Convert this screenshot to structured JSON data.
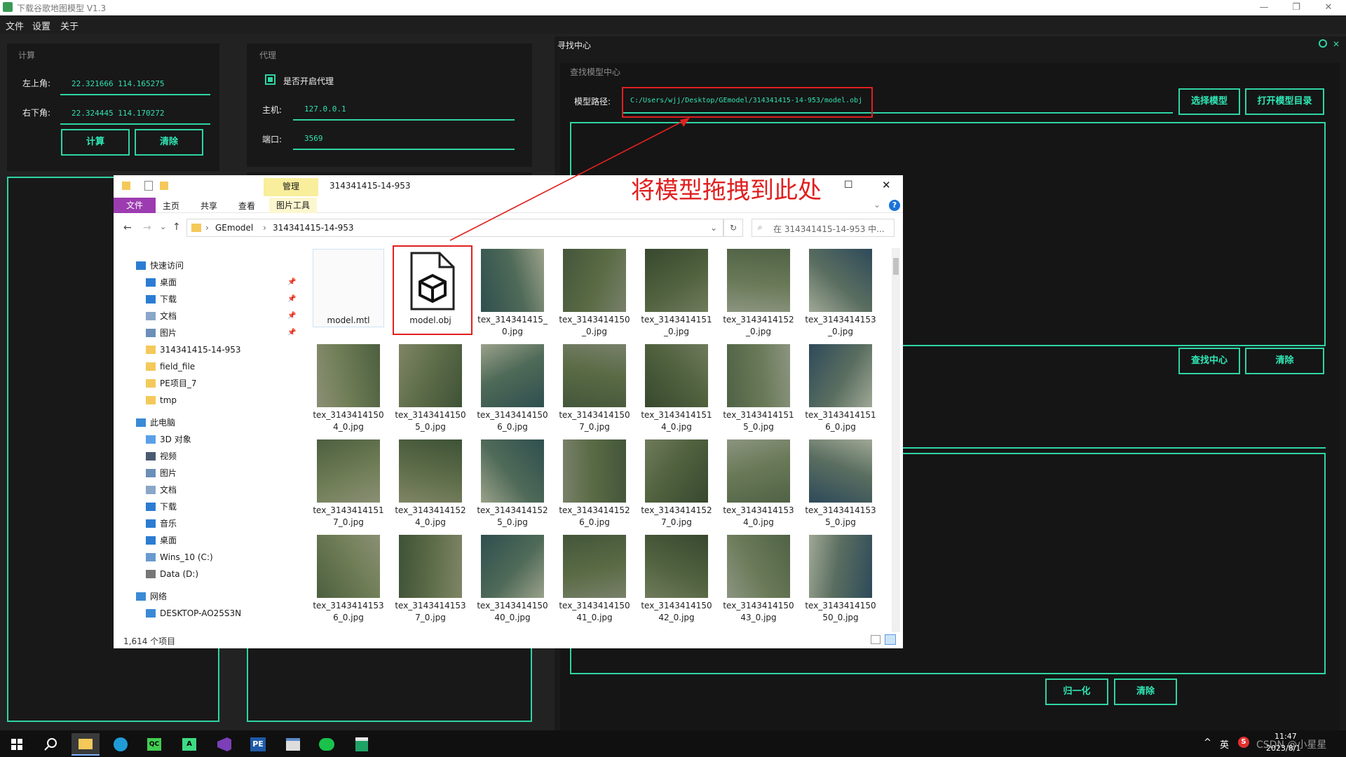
{
  "app": {
    "title": "下载谷歌地图模型 V1.3",
    "minimize": "—",
    "maximize": "❐",
    "close": "✕"
  },
  "menu": [
    "文件",
    "设置",
    "关于"
  ],
  "calc": {
    "title": "计算",
    "top_left_label": "左上角:",
    "top_left_value": "22.321666 114.165275",
    "bottom_right_label": "右下角:",
    "bottom_right_value": "22.324445 114.170272",
    "calc_btn": "计算",
    "clear_btn": "清除"
  },
  "proxy": {
    "title": "代理",
    "enable_label": "是否开启代理",
    "host_label": "主机:",
    "host_value": "127.0.0.1",
    "port_label": "端口:",
    "port_value": "3569"
  },
  "finder": {
    "tab": "寻找中心",
    "subtitle": "查找模型中心",
    "path_label": "模型路径:",
    "path_value": "C:/Users/wjj/Desktop/GEmodel/314341415-14-953/model.obj",
    "select_btn": "选择模型",
    "open_dir_btn": "打开模型目录",
    "find_btn": "查找中心",
    "clear_btn": "清除",
    "normalize_btn": "归一化",
    "clear_btn2": "清除"
  },
  "annotation": "将模型拖拽到此处",
  "explorer": {
    "title": "314341415-14-953",
    "manage_tab": "管理",
    "pic_tools": "图片工具",
    "ribbon": [
      "文件",
      "主页",
      "共享",
      "查看"
    ],
    "breadcrumb": [
      "GEmodel",
      "314341415-14-953"
    ],
    "search_placeholder": "在 314341415-14-953 中...",
    "nav": {
      "quick": "快速访问",
      "quick_items": [
        "桌面",
        "下载",
        "文档",
        "图片",
        "314341415-14-953",
        "field_file",
        "PE项目_7",
        "tmp"
      ],
      "pc": "此电脑",
      "pc_items": [
        "3D 对象",
        "视频",
        "图片",
        "文档",
        "下载",
        "音乐",
        "桌面",
        "Wins_10 (C:)",
        "Data (D:)"
      ],
      "network": "网络",
      "network_items": [
        "DESKTOP-AO25S3N"
      ]
    },
    "files": [
      {
        "l1": "model.mtl",
        "l2": ""
      },
      {
        "l1": "model.obj",
        "l2": ""
      },
      {
        "l1": "tex_314341415_",
        "l2": "0.jpg"
      },
      {
        "l1": "tex_3143414150",
        "l2": "_0.jpg"
      },
      {
        "l1": "tex_3143414151",
        "l2": "_0.jpg"
      },
      {
        "l1": "tex_3143414152",
        "l2": "_0.jpg"
      },
      {
        "l1": "tex_3143414153",
        "l2": "_0.jpg"
      },
      {
        "l1": "tex_3143414150",
        "l2": "4_0.jpg"
      },
      {
        "l1": "tex_3143414150",
        "l2": "5_0.jpg"
      },
      {
        "l1": "tex_3143414150",
        "l2": "6_0.jpg"
      },
      {
        "l1": "tex_3143414150",
        "l2": "7_0.jpg"
      },
      {
        "l1": "tex_3143414151",
        "l2": "4_0.jpg"
      },
      {
        "l1": "tex_3143414151",
        "l2": "5_0.jpg"
      },
      {
        "l1": "tex_3143414151",
        "l2": "6_0.jpg"
      },
      {
        "l1": "tex_3143414151",
        "l2": "7_0.jpg"
      },
      {
        "l1": "tex_3143414152",
        "l2": "4_0.jpg"
      },
      {
        "l1": "tex_3143414152",
        "l2": "5_0.jpg"
      },
      {
        "l1": "tex_3143414152",
        "l2": "6_0.jpg"
      },
      {
        "l1": "tex_3143414152",
        "l2": "7_0.jpg"
      },
      {
        "l1": "tex_3143414153",
        "l2": "4_0.jpg"
      },
      {
        "l1": "tex_3143414153",
        "l2": "5_0.jpg"
      },
      {
        "l1": "tex_3143414153",
        "l2": "6_0.jpg"
      },
      {
        "l1": "tex_3143414153",
        "l2": "7_0.jpg"
      },
      {
        "l1": "tex_3143414150",
        "l2": "40_0.jpg"
      },
      {
        "l1": "tex_3143414150",
        "l2": "41_0.jpg"
      },
      {
        "l1": "tex_3143414150",
        "l2": "42_0.jpg"
      },
      {
        "l1": "tex_3143414150",
        "l2": "43_0.jpg"
      },
      {
        "l1": "tex_3143414150",
        "l2": "50_0.jpg"
      }
    ],
    "status": "1,614 个项目"
  },
  "taskbar": {
    "ime": "英",
    "clock_time": "11:47",
    "clock_date": "2023/8/1",
    "watermark": "CSDN @小星星"
  },
  "colors": {
    "accent": "#2fd4a4",
    "annotation": "#e02020"
  }
}
